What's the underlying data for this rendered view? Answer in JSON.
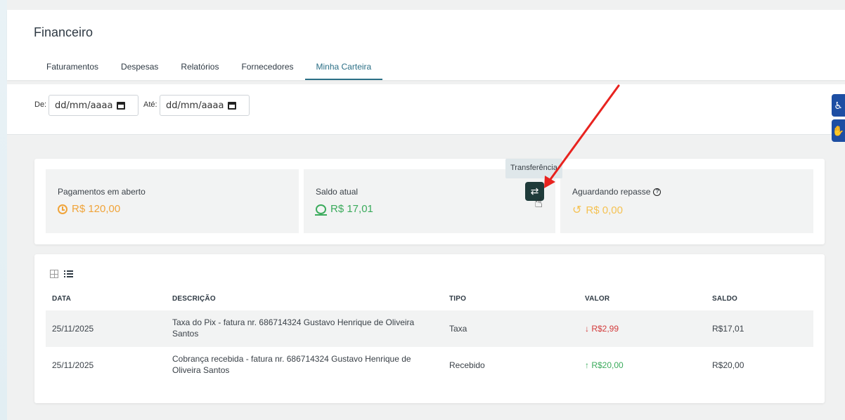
{
  "header": {
    "title": "Financeiro",
    "tabs": [
      {
        "label": "Faturamentos"
      },
      {
        "label": "Despesas"
      },
      {
        "label": "Relatórios"
      },
      {
        "label": "Fornecedores"
      },
      {
        "label": "Minha Carteira"
      }
    ],
    "active_tab": "Minha Carteira"
  },
  "filters": {
    "from_label": "De:",
    "from_placeholder": "dd/mm/aaaa",
    "to_label": "Até:",
    "to_placeholder": "dd/mm/aaaa"
  },
  "cards": {
    "open_label": "Pagamentos em aberto",
    "open_value": "R$ 120,00",
    "balance_label": "Saldo atual",
    "balance_value": "R$ 17,01",
    "pending_label": "Aguardando repasse",
    "pending_value": "R$ 0,00"
  },
  "transfer": {
    "tooltip": "Transferência",
    "icon": "transfer-icon"
  },
  "table": {
    "headers": {
      "date": "DATA",
      "description": "DESCRIÇÃO",
      "type": "TIPO",
      "value": "VALOR",
      "balance": "SALDO"
    },
    "rows": [
      {
        "date": "25/11/2025",
        "description": "Taxa do Pix - fatura nr. 686714324 Gustavo Henrique de Oliveira Santos",
        "type": "Taxa",
        "value": "↓ R$2,99",
        "balance": "R$17,01"
      },
      {
        "date": "25/11/2025",
        "description": "Cobrança recebida - fatura nr. 686714324 Gustavo Henrique de Oliveira Santos",
        "type": "Recebido",
        "value": "↑ R$20,00",
        "balance": "R$20,00"
      }
    ]
  },
  "colors": {
    "accent": "#2b6f86",
    "orange": "#f0a43a",
    "green": "#3bab5c",
    "red": "#d33b3b",
    "annotation_arrow": "#e8231f"
  }
}
